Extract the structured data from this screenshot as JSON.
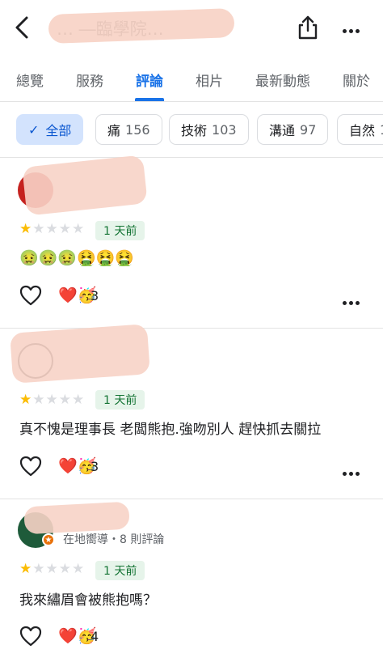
{
  "header": {
    "title": "… ―臨學院…"
  },
  "tabs": [
    {
      "label": "總覽"
    },
    {
      "label": "服務"
    },
    {
      "label": "評論"
    },
    {
      "label": "相片"
    },
    {
      "label": "最新動態"
    },
    {
      "label": "關於"
    }
  ],
  "active_tab": "評論",
  "chips": [
    {
      "label": "全部",
      "count": ""
    },
    {
      "label": "痛",
      "count": "156"
    },
    {
      "label": "技術",
      "count": "103"
    },
    {
      "label": "溝通",
      "count": "97"
    },
    {
      "label": "自然",
      "count": "1"
    }
  ],
  "colors": {
    "accent": "#1a73e8",
    "star": "#fbbc04",
    "date_badge_bg": "#e6f4ea",
    "date_badge_text": "#137333",
    "redaction": "#f7d3c6"
  },
  "reviews": [
    {
      "rating": 1,
      "max_rating": 5,
      "date": "1 天前",
      "text": "🤢🤢🤢🤮🤮🤮",
      "reaction_emoji": "❤️🥳",
      "reaction_count": "3"
    },
    {
      "rating": 1,
      "max_rating": 5,
      "date": "1 天前",
      "text": "真不愧是理事長 老闆熊抱.強吻別人 趕快抓去關拉",
      "reaction_emoji": "❤️🥳",
      "reaction_count": "3"
    },
    {
      "author_meta": "在地嚮導・8 則評論",
      "rating": 1,
      "max_rating": 5,
      "date": "1 天前",
      "text": "我來繡眉會被熊抱嗎？",
      "reaction_emoji": "❤️🥳",
      "reaction_count": "4"
    }
  ]
}
